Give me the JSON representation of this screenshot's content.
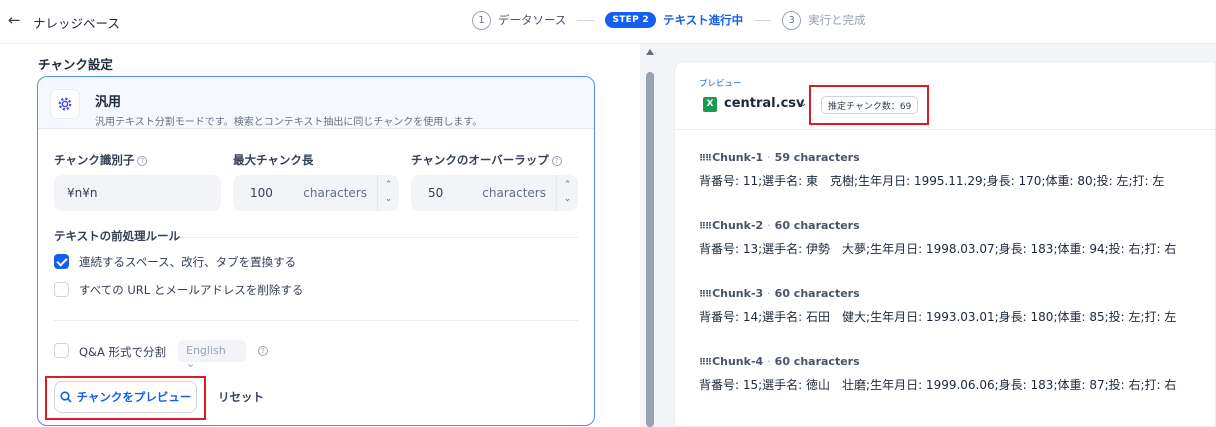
{
  "header": {
    "back_icon": "←",
    "title": "ナレッジベース",
    "steps": [
      {
        "num": "1",
        "label": "データソース"
      },
      {
        "badge": "STEP 2",
        "label": "テキスト進行中"
      },
      {
        "num": "3",
        "label": "実行と完成"
      }
    ]
  },
  "settings": {
    "section_title": "チャンク設定",
    "mode": {
      "title": "汎用",
      "description": "汎用テキスト分割モードです。検索とコンテキスト抽出に同じチャンクを使用します。"
    },
    "fields": {
      "identifier": {
        "label": "チャンク識別子",
        "value": "¥n¥n"
      },
      "max_length": {
        "label": "最大チャンク長",
        "value": "100",
        "unit": "characters"
      },
      "overlap": {
        "label": "チャンクのオーバーラップ",
        "value": "50",
        "unit": "characters"
      }
    },
    "preprocess": {
      "title": "テキストの前処理ルール",
      "rules": [
        {
          "label": "連続するスペース、改行、タブを置換する",
          "checked": true
        },
        {
          "label": "すべての URL とメールアドレスを削除する",
          "checked": false
        }
      ]
    },
    "qa": {
      "label": "Q&A 形式で分割",
      "language": "English"
    },
    "buttons": {
      "preview": "チャンクをプレビュー",
      "reset": "リセット"
    }
  },
  "preview": {
    "label": "プレビュー",
    "file_name": "central.csv",
    "estimate": "推定チャンク数：69",
    "chunks": [
      {
        "name": "Chunk-1",
        "chars": "59 characters",
        "text": "背番号: 11;選手名: 東　克樹;生年月日: 1995.11.29;身長: 170;体重: 80;投: 左;打: 左"
      },
      {
        "name": "Chunk-2",
        "chars": "60 characters",
        "text": "背番号: 13;選手名: 伊勢　大夢;生年月日: 1998.03.07;身長: 183;体重: 94;投: 右;打: 右"
      },
      {
        "name": "Chunk-3",
        "chars": "60 characters",
        "text": "背番号: 14;選手名: 石田　健大;生年月日: 1993.03.01;身長: 180;体重: 85;投: 左;打: 左"
      },
      {
        "name": "Chunk-4",
        "chars": "60 characters",
        "text": "背番号: 15;選手名: 徳山　壮磨;生年月日: 1999.06.06;身長: 183;体重: 87;投: 右;打: 右"
      }
    ]
  },
  "colors": {
    "accent": "#155eef",
    "highlight_box": "#d91f26"
  }
}
